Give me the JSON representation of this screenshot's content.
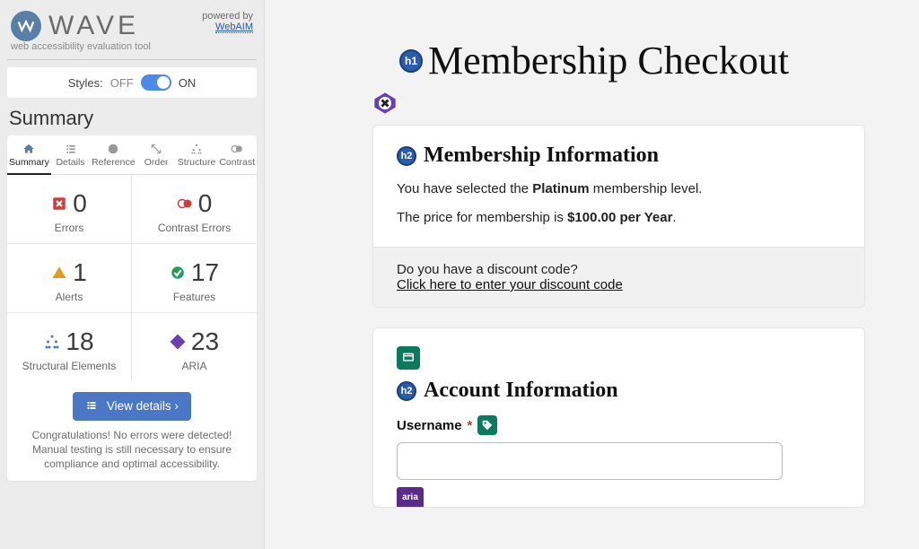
{
  "brand": {
    "name": "WAVE",
    "subtitle": "web accessibility evaluation tool",
    "powered_label": "powered by",
    "powered_link": "WebAIM"
  },
  "styles_toggle": {
    "label": "Styles:",
    "off": "OFF",
    "on": "ON"
  },
  "summary": {
    "title": "Summary",
    "tabs": [
      {
        "label": "Summary"
      },
      {
        "label": "Details"
      },
      {
        "label": "Reference"
      },
      {
        "label": "Order"
      },
      {
        "label": "Structure"
      },
      {
        "label": "Contrast"
      }
    ],
    "cells": {
      "errors": {
        "count": "0",
        "label": "Errors"
      },
      "contrast_errors": {
        "count": "0",
        "label": "Contrast Errors"
      },
      "alerts": {
        "count": "1",
        "label": "Alerts"
      },
      "features": {
        "count": "17",
        "label": "Features"
      },
      "structural": {
        "count": "18",
        "label": "Structural Elements"
      },
      "aria": {
        "count": "23",
        "label": "ARIA"
      }
    },
    "view_details": "View details ›",
    "congrats": "Congratulations! No errors were detected! Manual testing is still necessary to ensure compliance and optimal accessibility."
  },
  "page": {
    "h1_badge": "h1",
    "h1": "Membership Checkout",
    "membership": {
      "h2_badge": "h2",
      "h2": "Membership Information",
      "line1_pre": "You have selected the ",
      "line1_bold": "Platinum",
      "line1_post": " membership level.",
      "line2_pre": "The price for membership is ",
      "line2_bold": "$100.00 per Year",
      "line2_post": ".",
      "discount_q": "Do you have a discount code?",
      "discount_link": "Click here to enter your discount code"
    },
    "account": {
      "h2_badge": "h2",
      "h2": "Account Information",
      "username_label": "Username",
      "required_mark": "*",
      "aria_badge": "aria",
      "code_badge": "</>"
    }
  }
}
